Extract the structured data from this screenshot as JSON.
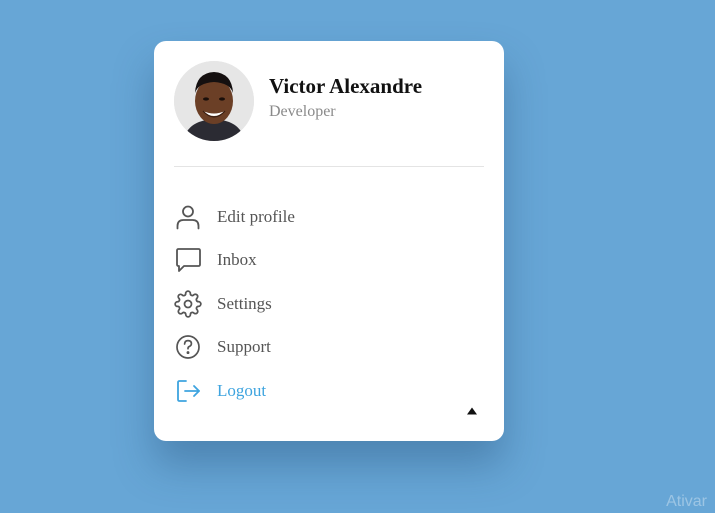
{
  "profile": {
    "name": "Victor Alexandre",
    "role": "Developer"
  },
  "menu": {
    "items": [
      {
        "label": "Edit profile",
        "icon": "user-icon"
      },
      {
        "label": "Inbox",
        "icon": "chat-icon"
      },
      {
        "label": "Settings",
        "icon": "gear-icon"
      },
      {
        "label": "Support",
        "icon": "help-circle-icon"
      },
      {
        "label": "Logout",
        "icon": "logout-icon"
      }
    ]
  },
  "toggle_icon": "caret-up-icon",
  "watermark": "Ativar",
  "colors": {
    "background": "#67a6d6",
    "card": "#ffffff",
    "text": "#555555",
    "accent": "#3ea4df"
  }
}
